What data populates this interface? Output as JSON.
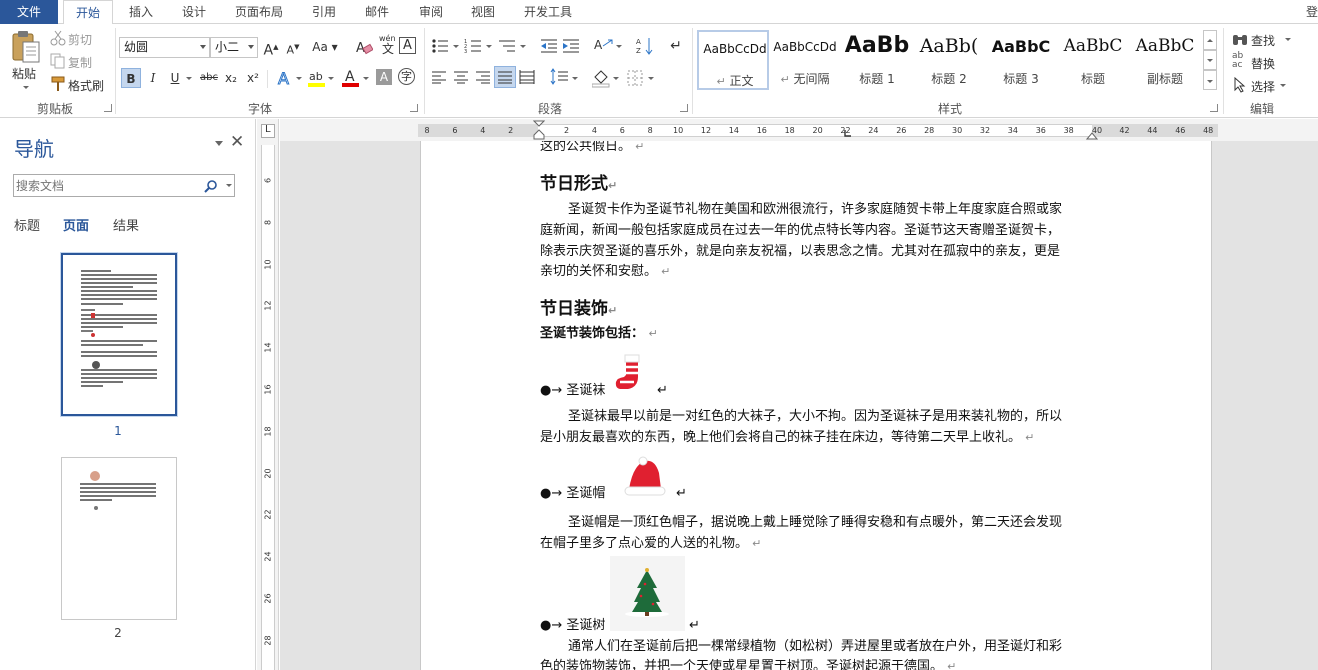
{
  "tabs": {
    "file": "文件",
    "home": "开始",
    "insert": "插入",
    "design": "设计",
    "layout": "页面布局",
    "references": "引用",
    "mailings": "邮件",
    "review": "审阅",
    "view": "视图",
    "developer": "开发工具",
    "login": "登"
  },
  "clipboard": {
    "paste": "粘贴",
    "cut": "剪切",
    "copy": "复制",
    "format_painter": "格式刷",
    "group": "剪贴板"
  },
  "font": {
    "name": "幼圆",
    "size": "小二",
    "group": "字体",
    "case_label": "Aa",
    "phonetic": "wén",
    "border_char": "A",
    "bold": "B",
    "italic": "I",
    "underline": "U",
    "strike": "abc",
    "subscript": "x₂",
    "superscript": "x²"
  },
  "paragraph": {
    "group": "段落"
  },
  "styles": {
    "group": "样式",
    "items": [
      {
        "preview": "AaBbCcDd",
        "name": "正文"
      },
      {
        "preview": "AaBbCcDd",
        "name": "无间隔"
      },
      {
        "preview": "AaBb",
        "name": "标题 1"
      },
      {
        "preview": "AaBb(",
        "name": "标题 2"
      },
      {
        "preview": "AaBbC",
        "name": "标题 3"
      },
      {
        "preview": "AaBbC",
        "name": "标题"
      },
      {
        "preview": "AaBbC",
        "name": "副标题"
      }
    ]
  },
  "editing": {
    "find": "查找",
    "replace": "替换",
    "select": "选择",
    "group": "编辑"
  },
  "nav": {
    "title": "导航",
    "search_placeholder": "搜索文档",
    "tabs": [
      "标题",
      "页面",
      "结果"
    ],
    "pages": [
      "1",
      "2"
    ]
  },
  "hruler_labels": [
    "8",
    "6",
    "4",
    "2",
    "",
    "2",
    "4",
    "6",
    "8",
    "10",
    "12",
    "14",
    "16",
    "18",
    "20",
    "22",
    "24",
    "26",
    "28",
    "30",
    "32",
    "34",
    "36",
    "38",
    "",
    "42",
    "44",
    "46",
    "48"
  ],
  "hruler_margin_label": "40",
  "vruler_labels": [
    "6",
    "8",
    "10",
    "12",
    "14",
    "16",
    "18",
    "20",
    "22",
    "24",
    "26",
    "28"
  ],
  "document": {
    "line0": "这的公共假日。",
    "heading1": "节日形式",
    "para1": [
      "圣诞贺卡作为圣诞节礼物在美国和欧洲很流行，许多家庭随贺卡带上年度家庭合照或家",
      "庭新闻，新闻一般包括家庭成员在过去一年的优点特长等内容。圣诞节这天寄赠圣诞贺卡，",
      "除表示庆贺圣诞的喜乐外，就是向亲友祝福，以表思念之情。尤其对在孤寂中的亲友，更是",
      "亲切的关怀和安慰。"
    ],
    "heading2": "节日装饰",
    "intro": "圣诞节装饰包括：",
    "item1": "圣诞袜",
    "para2": [
      "圣诞袜最早以前是一对红色的大袜子，大小不拘。因为圣诞袜子是用来装礼物的，所以",
      "是小朋友最喜欢的东西，晚上他们会将自己的袜子挂在床边，等待第二天早上收礼。"
    ],
    "item2": "圣诞帽",
    "para3": [
      "圣诞帽是一顶红色帽子，据说晚上戴上睡觉除了睡得安稳和有点暖外，第二天还会发现",
      "在帽子里多了点心爱的人送的礼物。"
    ],
    "item3": "圣诞树",
    "para4": [
      "通常人们在圣诞前后把一棵常绿植物（如松树）弄进屋里或者放在户外，用圣诞灯和彩",
      "色的装饰物装饰，并把一个天使或星星置于树顶。圣诞树起源于德国。"
    ],
    "bullet_char": "●→",
    "pilcrow": "↵"
  }
}
